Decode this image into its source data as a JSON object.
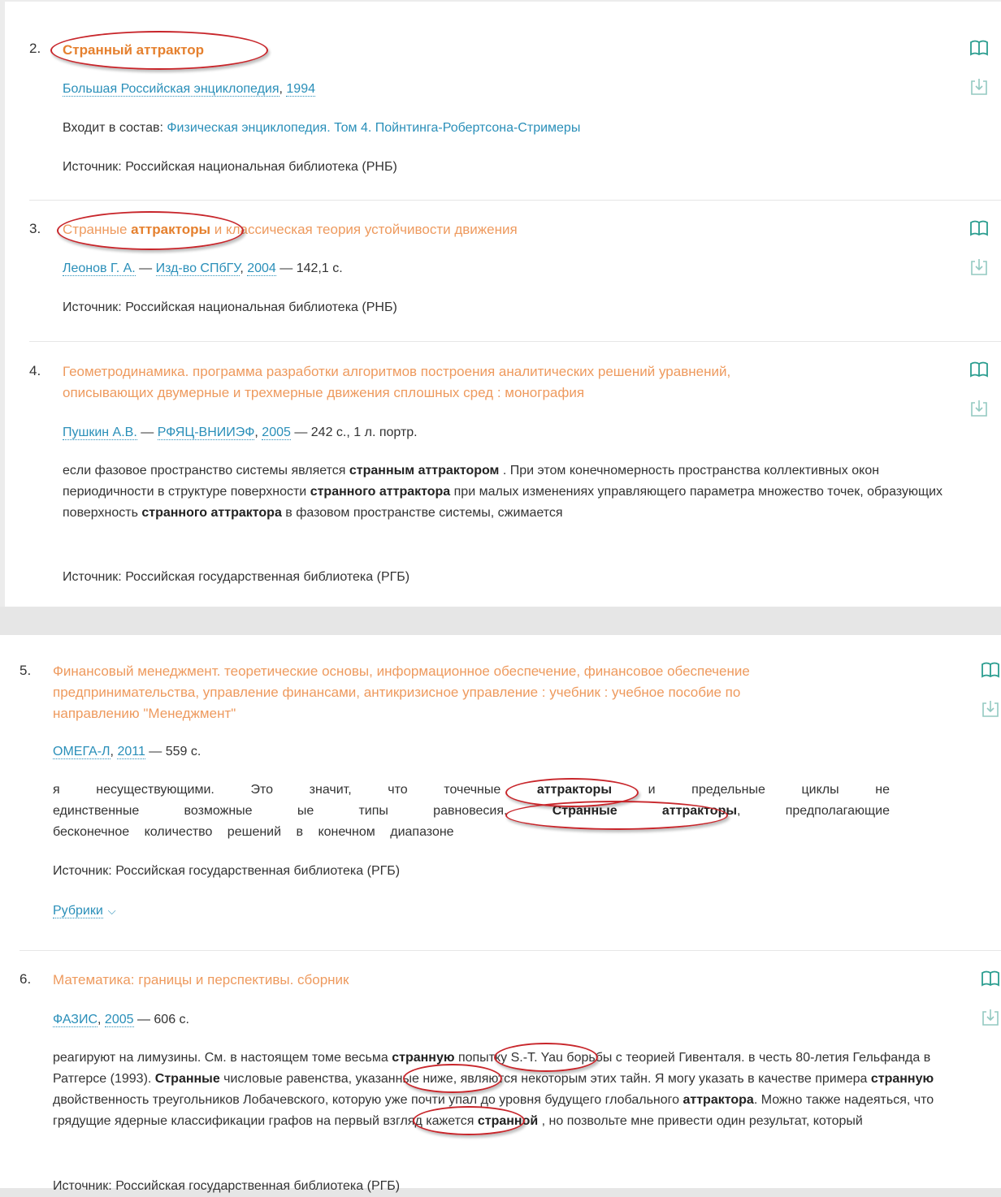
{
  "items": [
    {
      "number": "2.",
      "title": "Странный аттрактор",
      "meta": {
        "author": "Большая Российская энциклопедия",
        "sep1": ", ",
        "year": "1994"
      },
      "part_of": {
        "label": "Входит в состав: ",
        "value": "Физическая энциклопедия. Том 4. Пойнтинга-Робертсона-Стримеры"
      },
      "source": "Источник: Российская национальная библиотека (РНБ)"
    },
    {
      "number": "3.",
      "title": {
        "pre": "Странные ",
        "bold": "аттракторы",
        "post": " и классическая теория устойчивости движения"
      },
      "meta": {
        "author": "Леонов Г. А.",
        "dash1": " — ",
        "publisher": "Изд-во СПбГУ",
        "sep1": ", ",
        "year": "2004",
        "dash2": " — ",
        "pages": "142,1 с."
      },
      "source": "Источник: Российская национальная библиотека (РНБ)"
    },
    {
      "number": "4.",
      "title": {
        "line1": "Геометродинамика. программа разработки алгоритмов построения аналитических решений уравнений,",
        "line2": "описывающих двумерные и трехмерные движения сплошных сред : монография"
      },
      "meta": {
        "author": "Пушкин А.В.",
        "dash1": " — ",
        "publisher": "РФЯЦ-ВНИИЭФ",
        "sep1": ", ",
        "year": "2005",
        "dash2": " — ",
        "pages": "242 с., 1 л. портр."
      },
      "snippet": {
        "s1": "если фазовое пространство системы является ",
        "b1": "странным аттрактором",
        "s2": " . При этом конечномерность пространства коллективных окон периодичности в структуре поверхности ",
        "b2": "странного аттрактора",
        "s3": " при малых изменениях управляющего параметра множество точек, образующих поверхность ",
        "b3": "странного аттрактора",
        "s4": " в фазовом пространстве системы, сжимается"
      },
      "source": "Источник: Российская государственная библиотека (РГБ)"
    },
    {
      "number": "5.",
      "title": {
        "line1": "Финансовый менеджмент. теоретические основы, информационное обеспечение, финансовое обеспечение",
        "line2": "предпринимательства, управление финансами, антикризисное управление : учебник : учебное пособие по",
        "line3": "направлению \"Менеджмент\""
      },
      "meta": {
        "publisher": "ОМЕГА-Л",
        "sep1": ", ",
        "year": "2011",
        "dash2": " — ",
        "pages": "559 с."
      },
      "snippet": {
        "l1a": "я несуществующими. Это значит, что точечные ",
        "l1b": "аттракторы",
        "l1c": " и предельные циклы не",
        "l2a": "единственные возможные ые типы равновесия. ",
        "l2b": "Странные аттракторы",
        "l2c": ", предполагающие",
        "l3": "бесконечное количество решений в конечном диапазоне"
      },
      "source": "Источник: Российская государственная библиотека (РГБ)",
      "rubrics": "Рубрики"
    },
    {
      "number": "6.",
      "title": "Математика: границы и перспективы. сборник",
      "meta": {
        "publisher": "ФАЗИС",
        "sep1": ", ",
        "year": "2005",
        "dash2": " — ",
        "pages": "606 с."
      },
      "snippet": {
        "a1": "реагируют на лимузины. См. в настоящем томе весьма ",
        "b1": "странную",
        "a2": " попытку S.-T. Yau борьбы с теорией Гивенталя. в честь 80-летия Гельфанда в Ратгерсе (1993). ",
        "b2": "Странные",
        "a3": " числовые равенства, указанные ниже, являются некоторым этих тайн. Я могу указать в качестве примера ",
        "b3": "странную",
        "a4": " двойственность треугольников Лобачевского, которую уже почти упал до уровня будущего глобального ",
        "b4": "аттрактора",
        "a5": ". Можно также надеяться, что грядущие ядерные классификации графов на первый взгляд кажется ",
        "b5": "странной",
        "a6": " , но позвольте мне привести один результат, который"
      },
      "source": "Источник: Российская государственная библиотека (РГБ)"
    }
  ],
  "icons": {
    "read": "open-book-icon",
    "download": "download-icon"
  },
  "colors": {
    "title": "#ee9a5e",
    "link": "#2a8fb9",
    "highlight_oval": "#c8262b"
  }
}
